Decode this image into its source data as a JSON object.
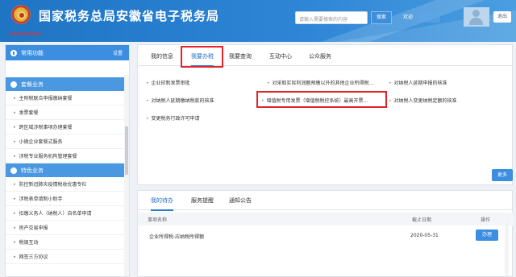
{
  "header": {
    "title": "国家税务总局安徽省电子税务局",
    "search_placeholder": "请输入需要搜索的内容",
    "search_button": "搜索",
    "welcome": "欢迎",
    "logout": "退出"
  },
  "sidebar": {
    "common_title": "常用功能",
    "common_action": "设置",
    "sections": [
      {
        "title": "套餐业务",
        "items": [
          "主附税联合申报缴纳套餐",
          "发票套餐",
          "跨区域涉税事项办理套餐",
          "小微企业套餐式服务",
          "涉税专业服务机构管理套餐"
        ]
      },
      {
        "title": "特色业务",
        "items": [
          "防控新冠肺炎疫情税收优惠专栏",
          "涉税表单填制小助手",
          "扣缴义务人（纳税人）自名单申请",
          "房产交易申报",
          "税银互动",
          "网签三方协议"
        ]
      }
    ]
  },
  "main": {
    "tabs": [
      "我的信息",
      "我要办税",
      "我要查询",
      "互动中心",
      "公众服务"
    ],
    "links": [
      "企业印制发票审批",
      "对采取实际利润额预缴以外的其他企业所得税...",
      "对纳税人延期申报的核准",
      "对纳税人延期缴纳税款的核准",
      "增值税专用发票（增值税税控系统）最高开票...",
      "对纳税人变更纳税定额的核准",
      "变更税务行政许可申请"
    ],
    "more_button": "更多"
  },
  "lower": {
    "tabs": [
      "我的待办",
      "服务提醒",
      "通知公告"
    ],
    "columns": [
      "事项名称",
      "截止日期",
      "操作"
    ],
    "rows": [
      {
        "name": "企业所得税-应纳税所得额",
        "deadline": "2020-05-31",
        "action": "办理"
      }
    ]
  }
}
